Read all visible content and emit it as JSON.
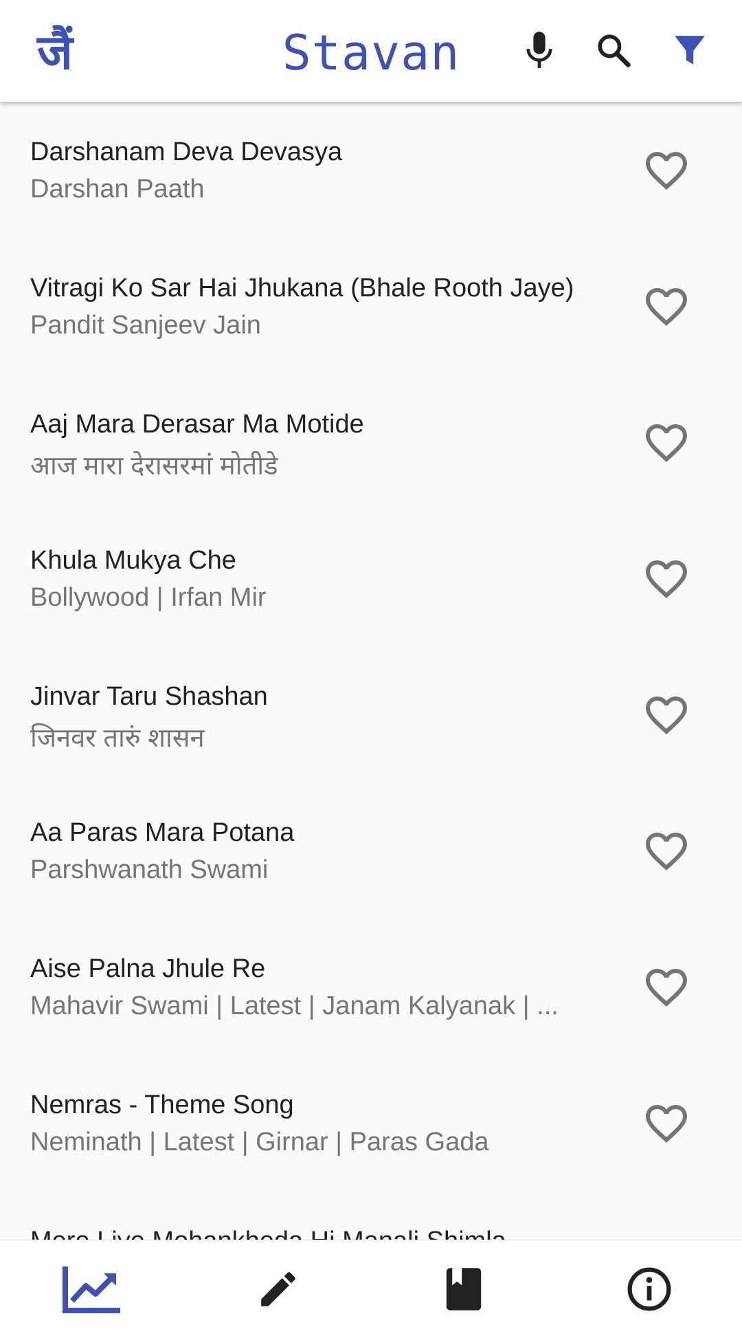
{
  "app_bar": {
    "title": "Stavan",
    "logo_text": "जैं",
    "actions": [
      {
        "icon": "mic-icon"
      },
      {
        "icon": "search-icon"
      },
      {
        "icon": "filter-icon"
      }
    ]
  },
  "colors": {
    "primary": "#3f51b5",
    "title_text": "#212121",
    "subtitle_text": "#757575",
    "heart_outline": "#757575",
    "background": "#fafafa",
    "icon_dark": "#212121"
  },
  "songs": [
    {
      "title": "Darshanam Deva Devasya",
      "subtitle": "Darshan Paath",
      "favorite_icon": "heart-outline-icon"
    },
    {
      "title": "Vitragi Ko Sar Hai Jhukana (Bhale Rooth Jaye)",
      "subtitle": "Pandit Sanjeev Jain",
      "favorite_icon": "heart-outline-icon"
    },
    {
      "title": "Aaj Mara Derasar Ma Motide",
      "subtitle": "आज मारा देरासरमां मोतीडे",
      "favorite_icon": "heart-outline-icon"
    },
    {
      "title": "Khula Mukya Che",
      "subtitle": "Bollywood | Irfan Mir",
      "favorite_icon": "heart-outline-icon"
    },
    {
      "title": "Jinvar Taru Shashan",
      "subtitle": "जिनवर तारुं शासन",
      "favorite_icon": "heart-outline-icon"
    },
    {
      "title": "Aa Paras Mara Potana",
      "subtitle": "Parshwanath Swami",
      "favorite_icon": "heart-outline-icon"
    },
    {
      "title": "Aise Palna Jhule Re",
      "subtitle": "Mahavir Swami | Latest | Janam Kalyanak | ...",
      "favorite_icon": "heart-outline-icon"
    },
    {
      "title": "Nemras - Theme Song",
      "subtitle": "Neminath | Latest | Girnar | Paras Gada",
      "favorite_icon": "heart-outline-icon"
    },
    {
      "title": "Mere Liye Mohankheda Hi Manali Shimla",
      "subtitle": "",
      "favorite_icon": "heart-outline-icon"
    }
  ],
  "bottom_nav": [
    {
      "icon": "trending-up-icon",
      "active": true
    },
    {
      "icon": "pencil-icon",
      "active": false
    },
    {
      "icon": "book-icon",
      "active": false
    },
    {
      "icon": "info-icon",
      "active": false
    }
  ]
}
